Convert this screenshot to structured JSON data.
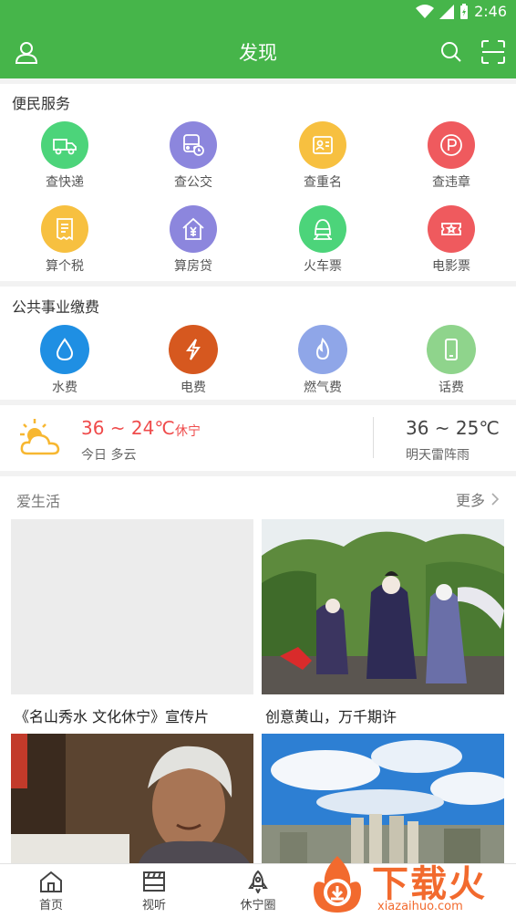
{
  "status": {
    "time": "2:46"
  },
  "header": {
    "title": "发现"
  },
  "convenience": {
    "title": "便民服务",
    "items": [
      {
        "label": "查快递",
        "icon": "truck-icon",
        "color": "#4cd47a"
      },
      {
        "label": "查公交",
        "icon": "bus-icon",
        "color": "#8c86dd"
      },
      {
        "label": "查重名",
        "icon": "id-card-icon",
        "color": "#f7c040"
      },
      {
        "label": "查违章",
        "icon": "parking-icon",
        "color": "#ef5a5e"
      },
      {
        "label": "算个税",
        "icon": "receipt-icon",
        "color": "#f7c040"
      },
      {
        "label": "算房贷",
        "icon": "house-yuan-icon",
        "color": "#8c86dd"
      },
      {
        "label": "火车票",
        "icon": "train-icon",
        "color": "#4cd47a"
      },
      {
        "label": "电影票",
        "icon": "ticket-icon",
        "color": "#ef5a5e"
      }
    ]
  },
  "utilities": {
    "title": "公共事业缴费",
    "items": [
      {
        "label": "水费",
        "icon": "water-drop-icon",
        "color": "#1f8fe3"
      },
      {
        "label": "电费",
        "icon": "lightning-icon",
        "color": "#d6581f"
      },
      {
        "label": "燃气费",
        "icon": "flame-icon",
        "color": "#8fa6e8"
      },
      {
        "label": "话费",
        "icon": "phone-icon",
        "color": "#8fd48c"
      }
    ]
  },
  "weather": {
    "today_temp": "36 ~ 24℃",
    "city": "休宁",
    "today_desc": "今日 多云",
    "tomorrow_temp": "36 ~ 25℃",
    "tomorrow_desc": "明天雷阵雨",
    "icon": "sun-cloud-icon"
  },
  "love_life": {
    "title": "爱生活",
    "more": "更多",
    "cards": [
      {
        "title": "《名山秀水 文化休宁》宣传片",
        "image": "placeholder-gray"
      },
      {
        "title": "创意黄山，万千期许",
        "image": "women-in-costume-photo"
      },
      {
        "title": "",
        "image": "elderly-woman-photo"
      },
      {
        "title": "",
        "image": "city-skyline-photo"
      }
    ]
  },
  "tabs": [
    {
      "label": "首页",
      "icon": "home-icon"
    },
    {
      "label": "视听",
      "icon": "film-icon"
    },
    {
      "label": "休宁圈",
      "icon": "rocket-icon"
    }
  ],
  "watermark": {
    "text": "下载火",
    "url": "xiazaihuo.com"
  }
}
